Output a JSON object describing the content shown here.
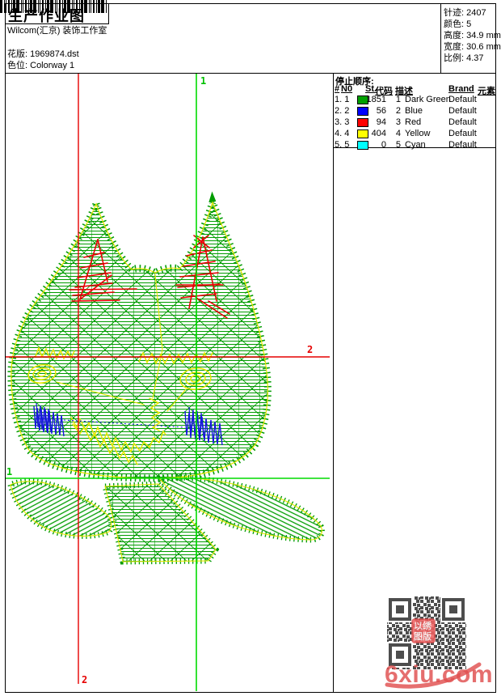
{
  "header": {
    "title": "生产作业图",
    "studio": "Wilcom(汇京) 装饰工作室",
    "pattern_label": "花版:",
    "pattern_value": "1969874.dst",
    "colorway_label": "色位:",
    "colorway_value": "Colorway 1"
  },
  "stats": {
    "rows": [
      {
        "label": "针迹:",
        "value": "2407"
      },
      {
        "label": "颜色:",
        "value": "5"
      },
      {
        "label": "高度:",
        "value": "34.9 mm"
      },
      {
        "label": "宽度:",
        "value": "30.6 mm"
      },
      {
        "label": "比例:",
        "value": "4.37"
      }
    ]
  },
  "stop_sequence": {
    "title": "停止顺序:",
    "columns": {
      "seq": "#",
      "needle": "N0",
      "stitches": "St.",
      "code": "代码",
      "desc": "描述",
      "brand": "Brand",
      "element": "元素"
    },
    "rows": [
      {
        "seq": "1. 1",
        "color": "#00a000",
        "st": "1851",
        "code": "1",
        "desc": "Dark Green",
        "brand": "Default"
      },
      {
        "seq": "2. 2",
        "color": "#0000ff",
        "st": "56",
        "code": "2",
        "desc": "Blue",
        "brand": "Default"
      },
      {
        "seq": "3. 3",
        "color": "#ff0000",
        "st": "94",
        "code": "3",
        "desc": "Red",
        "brand": "Default"
      },
      {
        "seq": "4. 4",
        "color": "#ffff00",
        "st": "404",
        "code": "4",
        "desc": "Yellow",
        "brand": "Default"
      },
      {
        "seq": "5. 5",
        "color": "#00ffff",
        "st": "0",
        "code": "5",
        "desc": "Cyan",
        "brand": "Default"
      }
    ]
  },
  "markers": {
    "start_top": "1",
    "start_left": "1",
    "end_right": "2",
    "end_bottom": "2"
  },
  "watermark": {
    "site": "6xiu.com",
    "seal_line1": "以绣",
    "seal_line2": "图版"
  },
  "design_colors": {
    "stitch_green": "#009c00",
    "outline_yellow": "#e8e800",
    "detail_red": "#e60000",
    "detail_blue": "#1616dc",
    "axis_green": "#00dc00",
    "axis_red": "#e60000",
    "qr_gray": "#4d4d4d"
  }
}
